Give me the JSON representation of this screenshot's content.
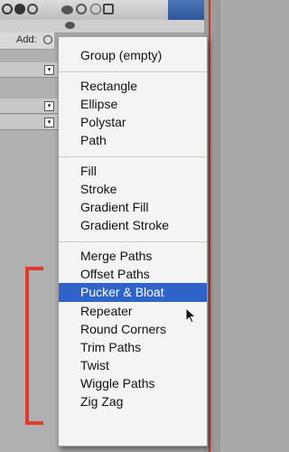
{
  "toolbar": {
    "add_label": "Add:"
  },
  "menu": {
    "items": [
      {
        "label": "Group (empty)"
      },
      {
        "label": "Rectangle"
      },
      {
        "label": "Ellipse"
      },
      {
        "label": "Polystar"
      },
      {
        "label": "Path"
      },
      {
        "label": "Fill"
      },
      {
        "label": "Stroke"
      },
      {
        "label": "Gradient Fill"
      },
      {
        "label": "Gradient Stroke"
      },
      {
        "label": "Merge Paths"
      },
      {
        "label": "Offset Paths"
      },
      {
        "label": "Pucker & Bloat"
      },
      {
        "label": "Repeater"
      },
      {
        "label": "Round Corners"
      },
      {
        "label": "Trim Paths"
      },
      {
        "label": "Twist"
      },
      {
        "label": "Wiggle Paths"
      },
      {
        "label": "Zig Zag"
      }
    ],
    "selected": "Pucker & Bloat"
  },
  "colors": {
    "highlight": "#2f63c9",
    "bracket": "#e23b2e"
  }
}
